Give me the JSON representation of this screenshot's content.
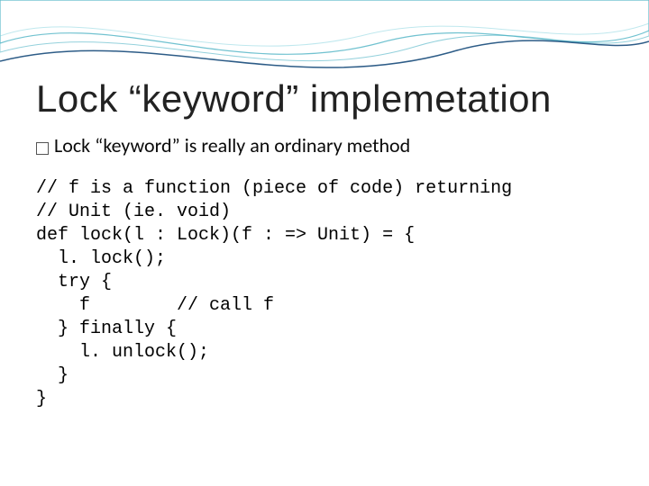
{
  "title": "Lock “keyword” implemetation",
  "subtitle": "Lock “keyword” is really an ordinary method",
  "code": "// f is a function (piece of code) returning\n// Unit (ie. void)\ndef lock(l : Lock)(f : => Unit) = {\n  l. lock();\n  try {\n    f        // call f\n  } finally {\n    l. unlock();\n  }\n}"
}
